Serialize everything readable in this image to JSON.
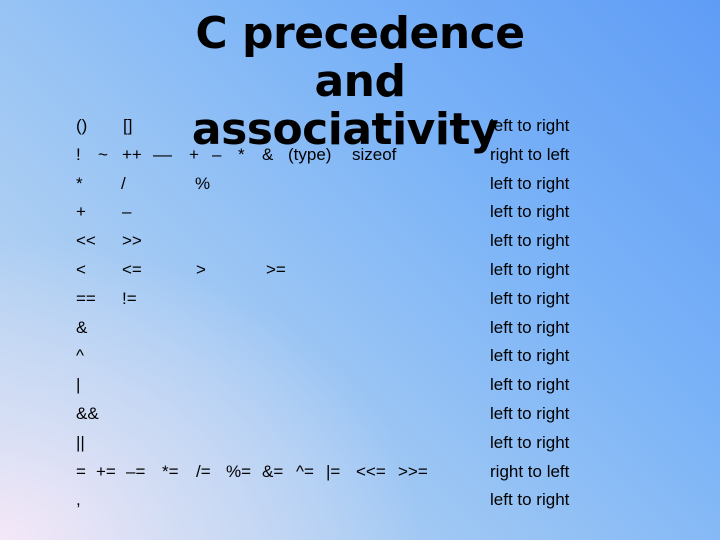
{
  "title": {
    "line1": "C  precedence and",
    "line2": "associativity"
  },
  "rows": [
    {
      "ops": [
        "()",
        "[]"
      ],
      "assoc": "left to right"
    },
    {
      "ops": [
        "!",
        "~",
        "++",
        "––",
        "+",
        "–",
        "*",
        "&",
        "(type)",
        "sizeof"
      ],
      "assoc": "right to left"
    },
    {
      "ops": [
        "*",
        "/",
        "%"
      ],
      "assoc": "left to right"
    },
    {
      "ops": [
        "+",
        "–"
      ],
      "assoc": "left to right"
    },
    {
      "ops": [
        "<<",
        ">>"
      ],
      "assoc": "left to right"
    },
    {
      "ops": [
        "<",
        "<=",
        ">",
        ">="
      ],
      "assoc": "left to right"
    },
    {
      "ops": [
        "==",
        "!="
      ],
      "assoc": "left to right"
    },
    {
      "ops": [
        "&"
      ],
      "assoc": "left to right"
    },
    {
      "ops": [
        "^"
      ],
      "assoc": "left to right"
    },
    {
      "ops": [
        "|"
      ],
      "assoc": "left to right"
    },
    {
      "ops": [
        "&&"
      ],
      "assoc": "left to right"
    },
    {
      "ops": [
        "||"
      ],
      "assoc": "left to right"
    },
    {
      "ops": [
        "=",
        "+=",
        "–=",
        "*=",
        "/=",
        "%=",
        "&=",
        "^=",
        "|=",
        "<<=",
        ">>="
      ],
      "assoc": "right to left"
    },
    {
      "ops": [
        ","
      ],
      "assoc": "left to right"
    }
  ]
}
